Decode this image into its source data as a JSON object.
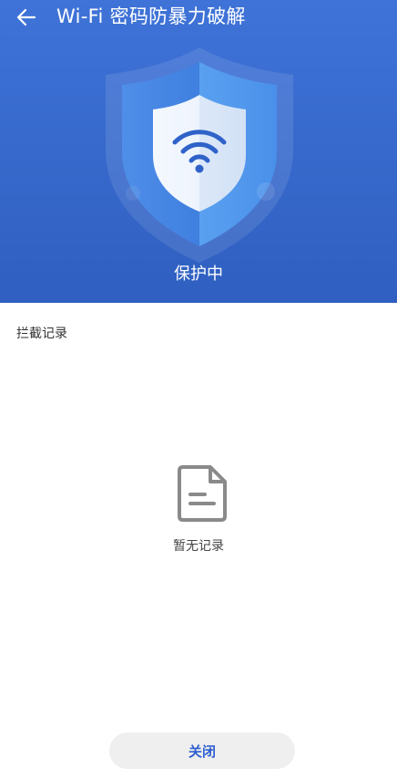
{
  "header": {
    "title": "Wi-Fi 密码防暴力破解",
    "back_icon": "arrow-left-icon",
    "background_color": "#3566cc"
  },
  "status": {
    "text": "保护中",
    "shield_icon": "wifi-shield-icon"
  },
  "records": {
    "section_label": "拦截记录",
    "empty_icon": "document-icon",
    "empty_text": "暂无记录"
  },
  "footer": {
    "close_label": "关闭",
    "accent_color": "#2f5fd0"
  }
}
